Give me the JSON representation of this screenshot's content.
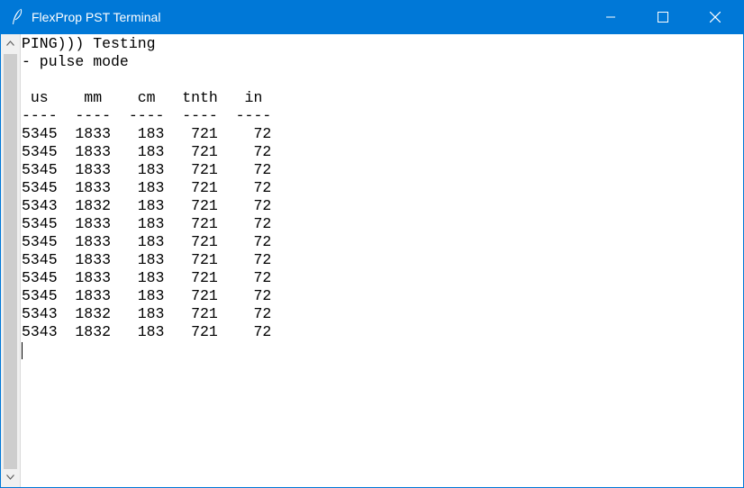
{
  "window": {
    "title": "FlexProp PST Terminal",
    "icons": {
      "app": "feather-icon",
      "minimize": "minimize-icon",
      "maximize": "maximize-icon",
      "close": "close-icon"
    },
    "colors": {
      "titlebar": "#0078d7",
      "title_text": "#ffffff",
      "terminal_bg": "#ffffff",
      "terminal_text": "#000000"
    }
  },
  "scrollbar": {
    "up_icon": "chevron-up-icon",
    "down_icon": "chevron-down-icon"
  },
  "terminal": {
    "lines": [
      "PING))) Testing",
      "- pulse mode",
      "",
      " us    mm    cm   tnth   in",
      "----  ----  ----  ----  ----",
      "5345  1833   183   721    72",
      "5345  1833   183   721    72",
      "5345  1833   183   721    72",
      "5345  1833   183   721    72",
      "5343  1832   183   721    72",
      "5345  1833   183   721    72",
      "5345  1833   183   721    72",
      "5345  1833   183   721    72",
      "5345  1833   183   721    72",
      "5345  1833   183   721    72",
      "5343  1832   183   721    72",
      "5343  1832   183   721    72"
    ]
  }
}
